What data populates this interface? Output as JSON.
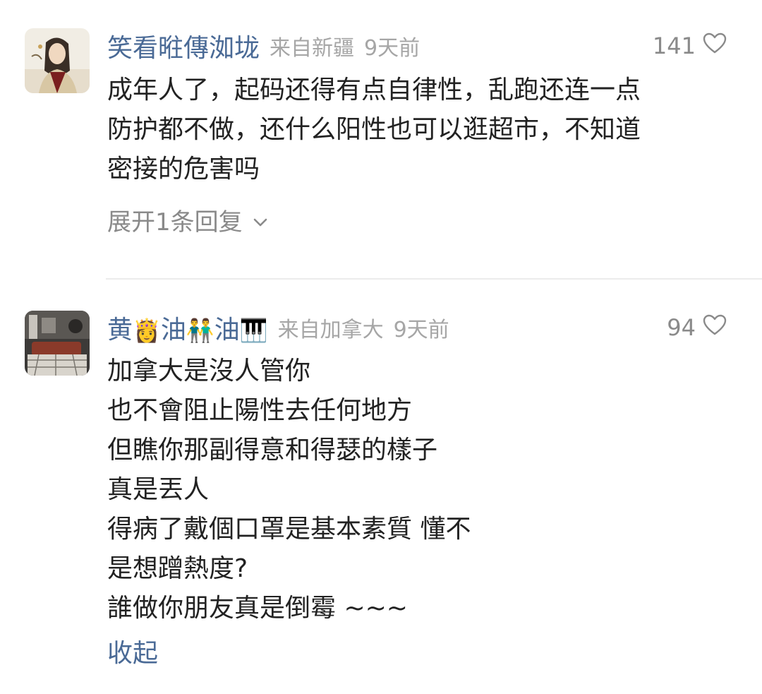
{
  "comments": [
    {
      "username": "笑看暀傳洳垅",
      "location": "来自新疆",
      "time": "9天前",
      "likes": "141",
      "lines": [
        "成年人了，起码还得有点自律性，乱跑还连一点",
        "防护都不做，还什么阳性也可以逛超市，不知道",
        "密接的危害吗"
      ],
      "expand_label": "展开1条回复"
    },
    {
      "username_parts": [
        "黄",
        "👸",
        "油",
        "👬",
        "油",
        "🎹"
      ],
      "location": "来自加拿大",
      "time": "9天前",
      "likes": "94",
      "lines": [
        "加拿大是沒人管你",
        "也不會阻止陽性去任何地方",
        "但瞧你那副得意和得瑟的樣子",
        "真是丟人",
        "得病了戴個口罩是基本素質 懂不",
        "是想蹭熱度?",
        "誰做你朋友真是倒霉 ~~~"
      ],
      "collapse_label": "收起"
    }
  ],
  "icons": {
    "heart": "heart-icon",
    "chevron": "chevron-down-icon"
  },
  "colors": {
    "username": "#4a6a96",
    "meta": "#a6a6a6",
    "text": "#222222",
    "action": "#8a8a8a"
  }
}
